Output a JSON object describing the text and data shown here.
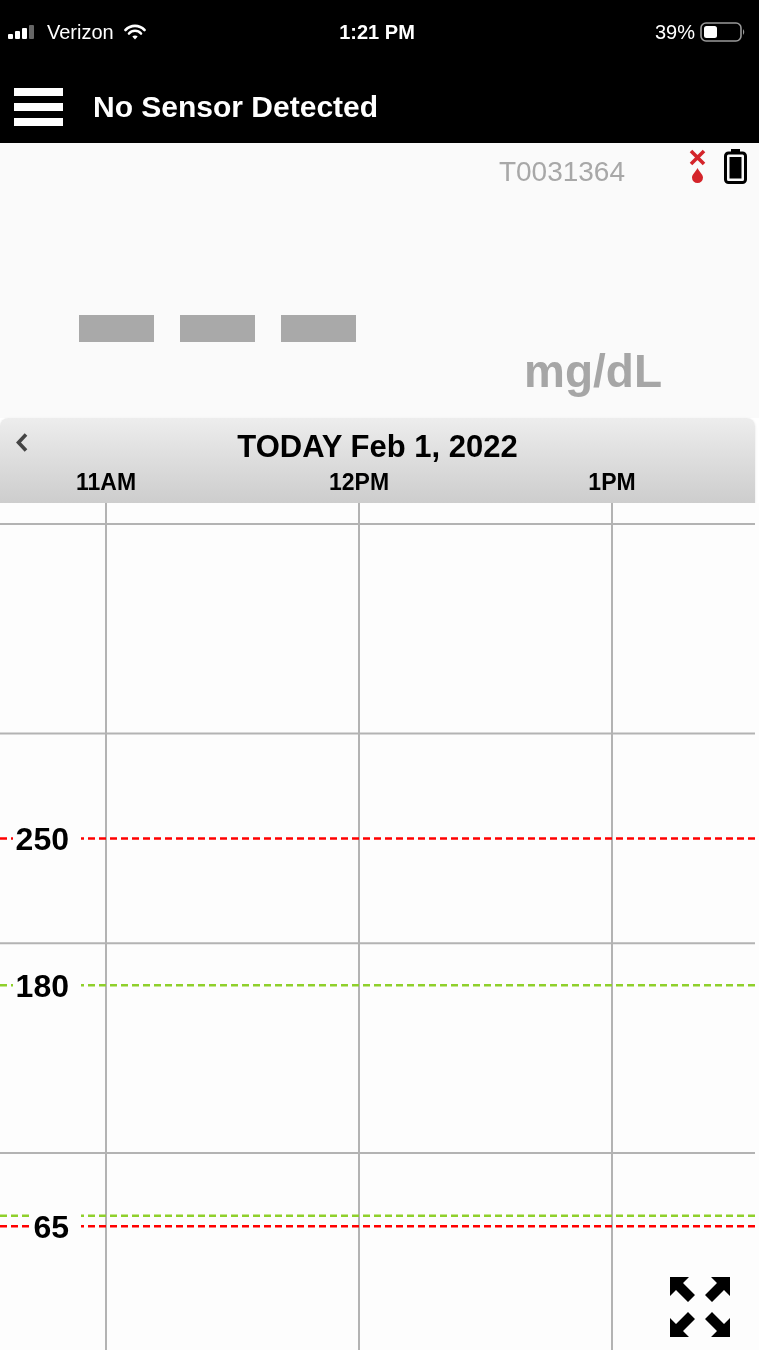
{
  "status_bar": {
    "carrier": "Verizon",
    "time": "1:21 PM",
    "battery": "39%"
  },
  "header": {
    "title": "No Sensor Detected"
  },
  "reading_panel": {
    "transmitter_id": "T0031364",
    "unit": "mg/dL"
  },
  "date_bar": {
    "title": "TODAY Feb 1, 2022"
  },
  "chart": {
    "chart_data": {
      "type": "line",
      "categories": [
        "11AM",
        "12PM",
        "1PM"
      ],
      "ylim": [
        6,
        410
      ],
      "yticks": [
        65,
        180,
        250
      ],
      "grid": true,
      "ref_lines": [
        {
          "axis": "y",
          "value": 250,
          "color": "#ff0000"
        },
        {
          "axis": "y",
          "value": 180,
          "color": "#8fd02c"
        },
        {
          "axis": "y",
          "value": 70,
          "color": "#8fd02c"
        },
        {
          "axis": "y",
          "value": 65,
          "color": "#ff0000"
        }
      ]
    }
  }
}
